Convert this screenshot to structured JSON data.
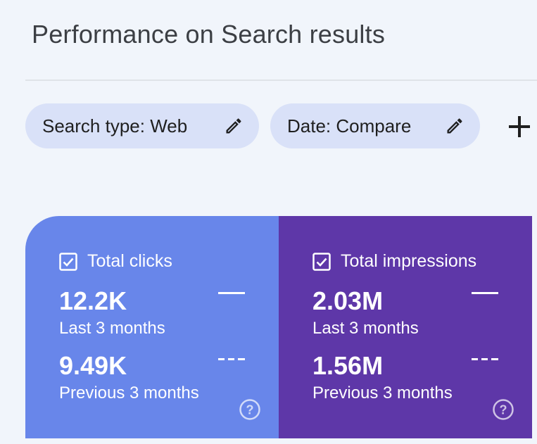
{
  "page": {
    "title": "Performance on Search results"
  },
  "filters": [
    {
      "label": "Search type: Web",
      "icon": "pencil-icon"
    },
    {
      "label": "Date: Compare",
      "icon": "pencil-icon"
    }
  ],
  "add_filter_icon": "plus-icon",
  "metrics": [
    {
      "title": "Total clicks",
      "checked": true,
      "current_value": "12.2K",
      "current_period": "Last 3 months",
      "previous_value": "9.49K",
      "previous_period": "Previous 3 months",
      "color": "#6886ea"
    },
    {
      "title": "Total impressions",
      "checked": true,
      "current_value": "2.03M",
      "current_period": "Last 3 months",
      "previous_value": "1.56M",
      "previous_period": "Previous 3 months",
      "color": "#5e37a8"
    }
  ],
  "colors": {
    "background": "#f1f5fb",
    "chip": "#d9e1f8",
    "clicks": "#6886ea",
    "impressions": "#5e37a8"
  }
}
